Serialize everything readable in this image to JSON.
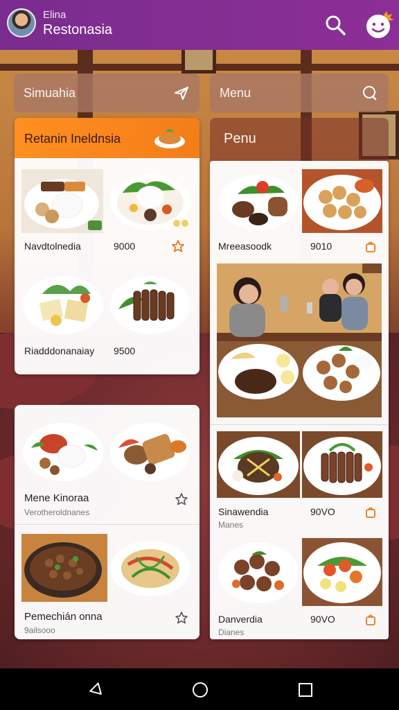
{
  "header": {
    "user_name": "Elina",
    "app_title": "Restonasia"
  },
  "search": {
    "left_label": "Simuahia",
    "right_label": "Menu"
  },
  "card_left": {
    "title": "Retanin Ineldnsia",
    "row1": {
      "label": "Navdtolnedia",
      "price": "9000"
    },
    "row2": {
      "label": "Riadddonanaiay",
      "price": "9500"
    }
  },
  "card_left2": {
    "item1": {
      "label": "Mene Kinoraa",
      "sub": "Verotheroldnanes"
    },
    "item2": {
      "label": "Pemechián onna",
      "sub": "9ailsooo"
    }
  },
  "menu_panel": {
    "title": "Penu",
    "row1": {
      "label": "Mreeasoodk",
      "price": "9010"
    },
    "row2": {
      "label": "Sinawendia",
      "sub": "Manes",
      "price": "90VO"
    },
    "row3": {
      "label": "Danverdia",
      "sub": "Dianes",
      "price": "90VO"
    }
  },
  "colors": {
    "app_bar": "#8c2f96",
    "card_header": "#f47d18",
    "accent_icon": "#e07a20"
  },
  "icons": [
    "search-icon",
    "smile-brand-icon",
    "plane-icon",
    "chat-icon",
    "star-icon",
    "bag-icon",
    "back-icon",
    "home-icon",
    "recents-icon"
  ]
}
